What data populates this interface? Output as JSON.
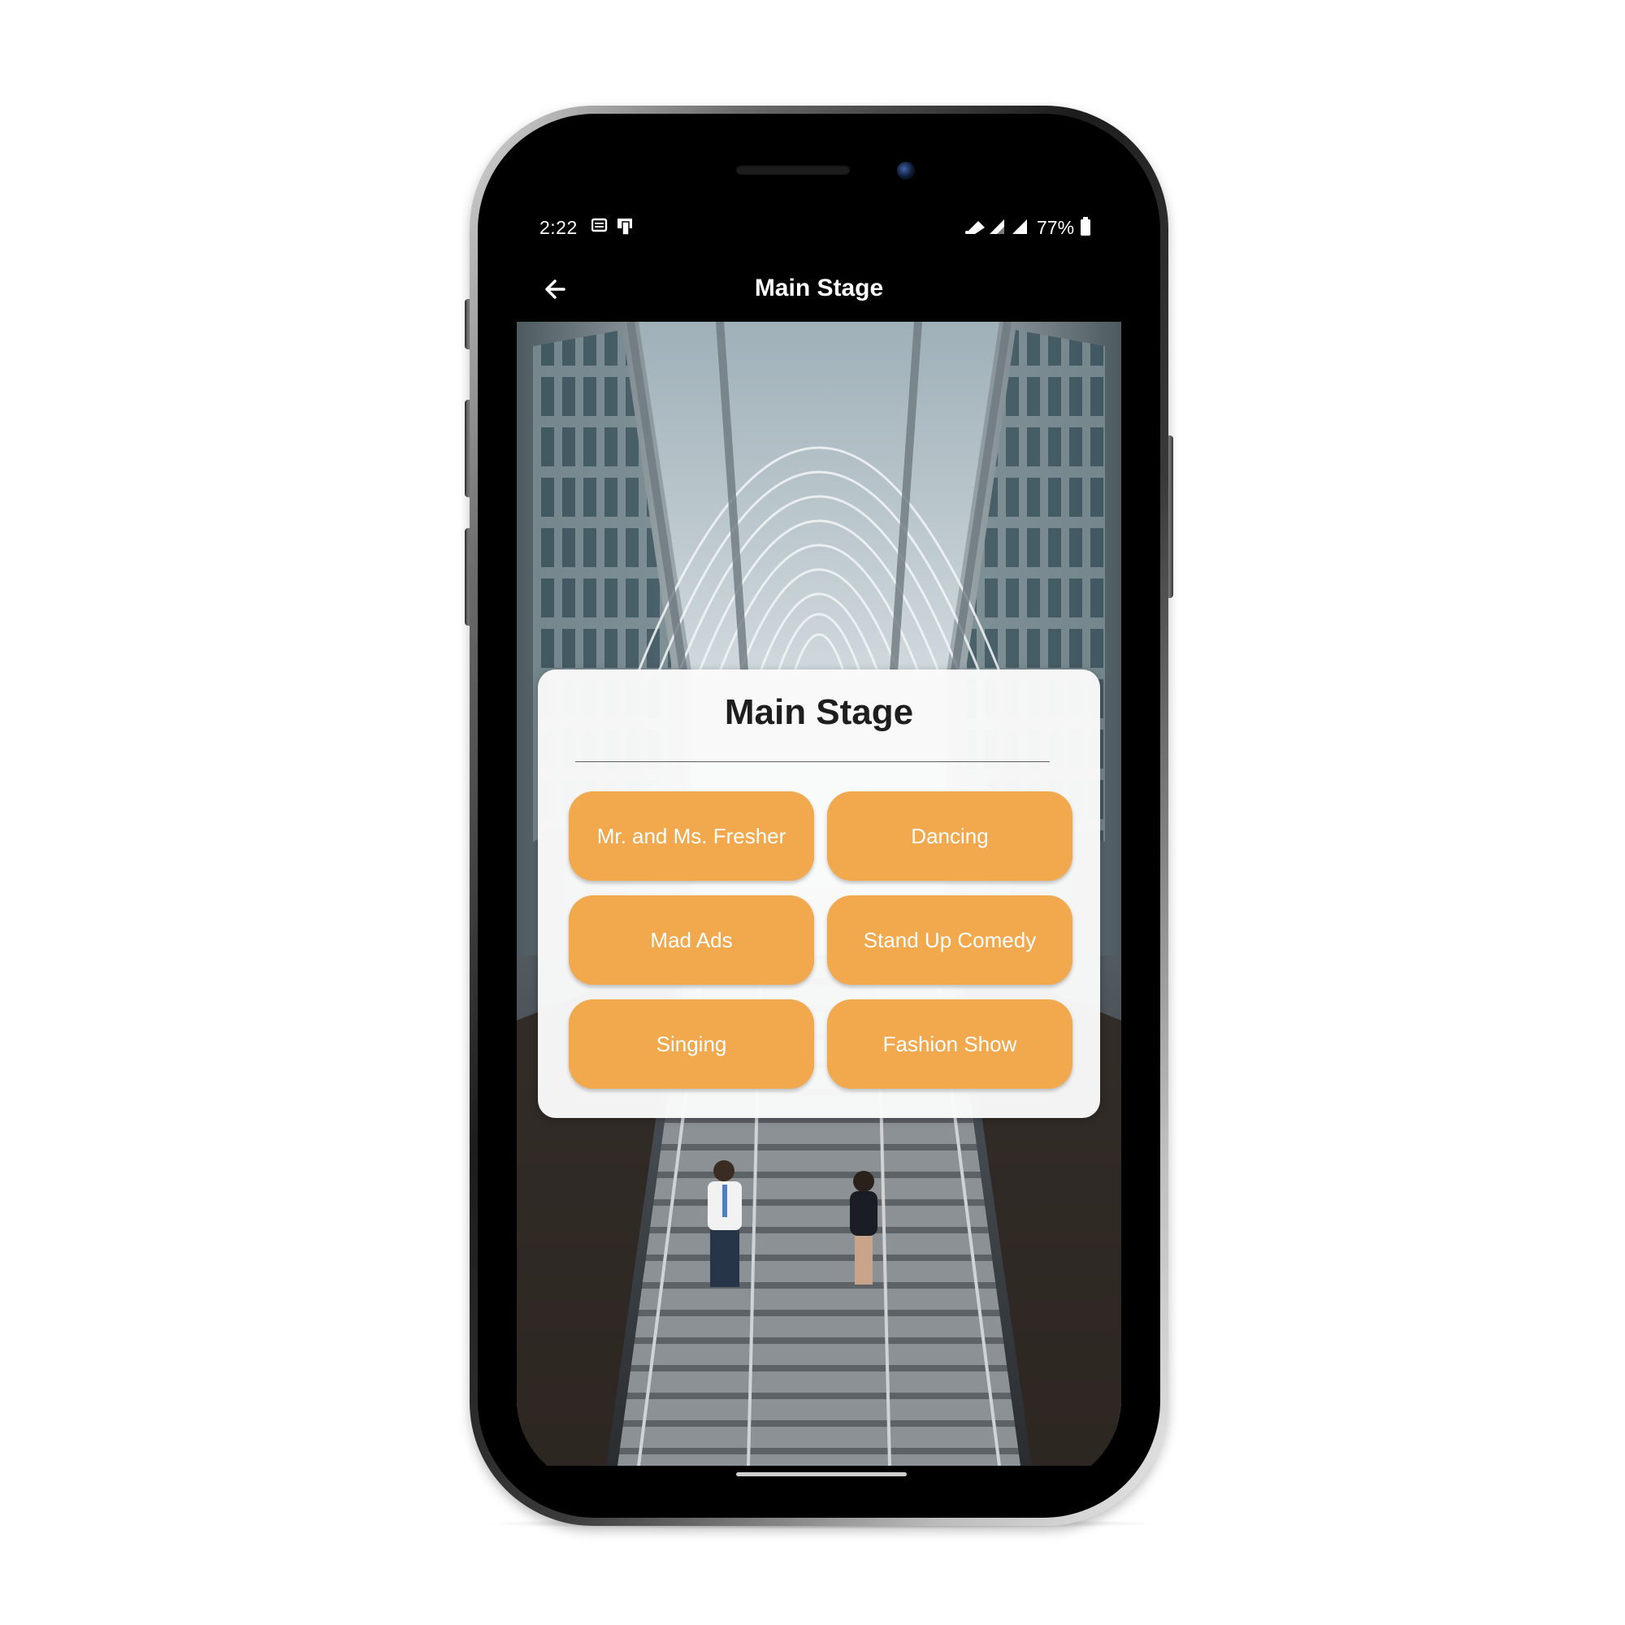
{
  "status_bar": {
    "time": "2:22",
    "battery": "77%",
    "left_icons": [
      "news-icon",
      "cast-icon"
    ],
    "right_icons": [
      "wifi-icon",
      "signal-icon",
      "signal-icon",
      "battery-icon"
    ]
  },
  "app_bar": {
    "title": "Main Stage",
    "back_icon": "arrow-left-icon"
  },
  "card": {
    "title": "Main Stage",
    "buttons": [
      {
        "label": "Mr. and Ms. Fresher"
      },
      {
        "label": "Dancing"
      },
      {
        "label": "Mad Ads"
      },
      {
        "label": "Stand Up Comedy"
      },
      {
        "label": "Singing"
      },
      {
        "label": "Fashion Show"
      }
    ]
  },
  "colors": {
    "accent": "#f2a84c",
    "screen_background": "#000000",
    "card_background": "#fafafa"
  }
}
